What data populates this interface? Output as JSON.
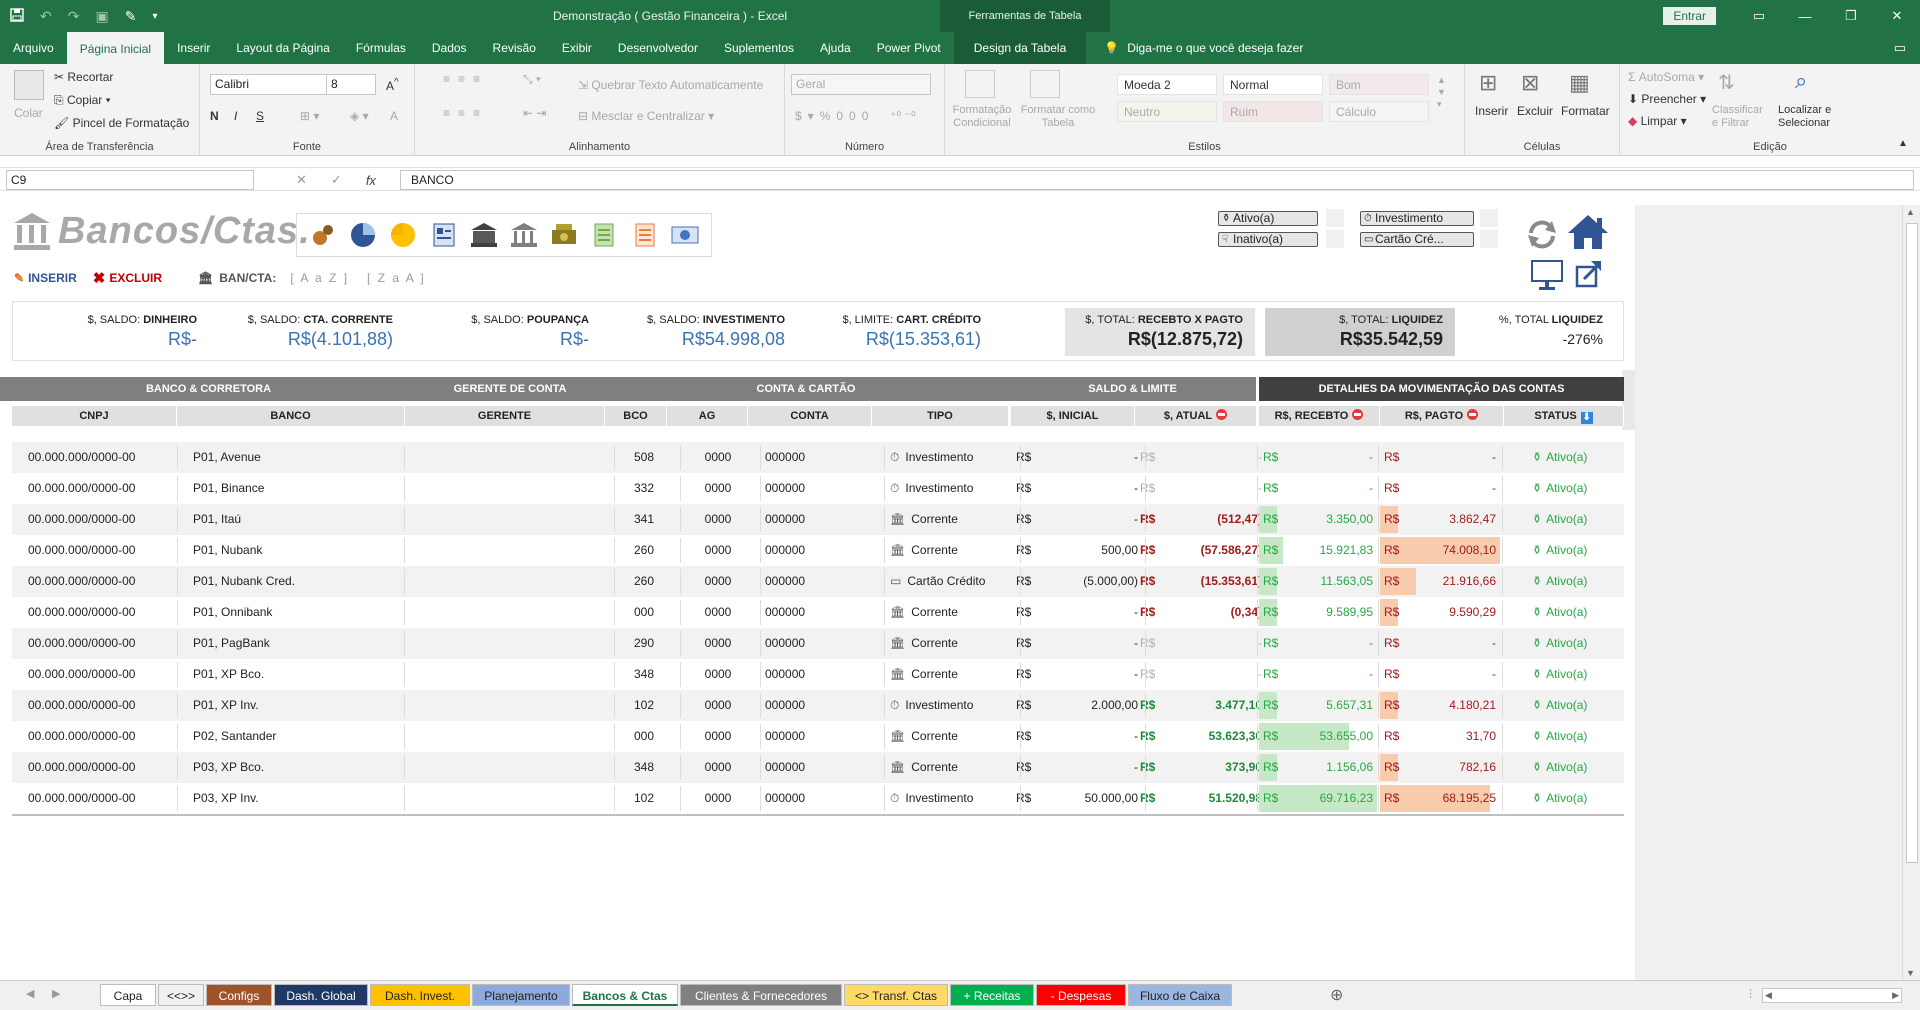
{
  "titlebar": {
    "title": "Demonstração ( Gestão Financeira ) - Excel",
    "tools": "Ferramentas de Tabela",
    "entrar": "Entrar"
  },
  "ribbon_tabs": [
    "Arquivo",
    "Página Inicial",
    "Inserir",
    "Layout da Página",
    "Fórmulas",
    "Dados",
    "Revisão",
    "Exibir",
    "Desenvolvedor",
    "Suplementos",
    "Ajuda",
    "Power Pivot",
    "Design da Tabela"
  ],
  "tell_me": "Diga-me o que você deseja fazer",
  "ribbon": {
    "clipboard": {
      "label": "Área de Transferência",
      "colar": "Colar",
      "recortar": "Recortar",
      "copiar": "Copiar",
      "pincel": "Pincel de Formatação"
    },
    "font": {
      "label": "Fonte",
      "name": "Calibri",
      "size": "8",
      "bold": "N",
      "italic": "I",
      "underline": "S"
    },
    "align": {
      "label": "Alinhamento",
      "wrap": "Quebrar Texto Automaticamente",
      "merge": "Mesclar e Centralizar"
    },
    "number": {
      "label": "Número",
      "format": "Geral"
    },
    "styles": {
      "label": "Estilos",
      "cond": "Formatação Condicional",
      "table": "Formatar como Tabela",
      "cells": [
        "Moeda 2",
        "Normal",
        "Bom",
        "Neutro",
        "Ruim",
        "Cálculo"
      ]
    },
    "cells": {
      "label": "Células",
      "insert": "Inserir",
      "delete": "Excluir",
      "format": "Formatar"
    },
    "editing": {
      "label": "Edição",
      "autosum": "AutoSoma",
      "fill": "Preencher",
      "clear": "Limpar",
      "sort": "Classificar e Filtrar",
      "find": "Localizar e Selecionar"
    }
  },
  "formula_bar": {
    "cell": "C9",
    "value": "BANCO"
  },
  "sheet": {
    "title": "Bancos/Ctas.",
    "legend": {
      "ativo": "Ativo(a)",
      "inativo": "Inativo(a)",
      "investimento": "Investimento",
      "cartao": "Cartão Cré..."
    },
    "actions": {
      "insert": "INSERIR",
      "delete": "EXCLUIR",
      "bancta": "BAN/CTA:",
      "az": "[ A a Z ]",
      "za": "[ Z a A ]"
    },
    "kpis": [
      {
        "prefix": "$, SALDO: ",
        "bold": "DINHEIRO",
        "value": "R$-"
      },
      {
        "prefix": "$, SALDO: ",
        "bold": "CTA. CORRENTE",
        "value": "R$(4.101,88)"
      },
      {
        "prefix": "$, SALDO: ",
        "bold": "POUPANÇA",
        "value": "R$-"
      },
      {
        "prefix": "$, SALDO: ",
        "bold": "INVESTIMENTO",
        "value": "R$54.998,08"
      },
      {
        "prefix": "$, LIMITE: ",
        "bold": "CART. CRÉDITO",
        "value": "R$(15.353,61)"
      },
      {
        "prefix": "$, TOTAL: ",
        "bold": "RECEBTO X PAGTO",
        "value": "R$(12.875,72)"
      },
      {
        "prefix": "$, TOTAL: ",
        "bold": "LIQUIDEZ",
        "value": "R$35.542,59"
      },
      {
        "prefix": "%, TOTAL ",
        "bold": "LIQUIDEZ",
        "value": "-276%"
      }
    ],
    "group_headers": [
      "BANCO & CORRETORA",
      "GERENTE DE CONTA",
      "CONTA & CARTÃO",
      "SALDO  & LIMITE",
      "DETALHES DA MOVIMENTAÇÃO DAS CONTAS"
    ],
    "columns": [
      "CNPJ",
      "BANCO",
      "GERENTE",
      "BCO",
      "AG",
      "CONTA",
      "TIPO",
      "$, INICIAL",
      "$, ATUAL",
      "R$, RECEBTO",
      "R$, PAGTO",
      "STATUS"
    ],
    "rows": [
      {
        "cnpj": "00.000.000/0000-00",
        "banco": "P01, Avenue",
        "bco": "508",
        "ag": "0000",
        "conta": "000000",
        "tipo": "Investimento",
        "inicial": "-",
        "atual": "-",
        "atual_cls": "grayv",
        "rec": "-",
        "rec_bar": 0,
        "pag": "-",
        "pag_bar": 0,
        "status": "Ativo(a)"
      },
      {
        "cnpj": "00.000.000/0000-00",
        "banco": "P01, Binance",
        "bco": "332",
        "ag": "0000",
        "conta": "000000",
        "tipo": "Investimento",
        "inicial": "-",
        "atual": "-",
        "atual_cls": "grayv",
        "rec": "-",
        "rec_bar": 0,
        "pag": "-",
        "pag_bar": 0,
        "status": "Ativo(a)"
      },
      {
        "cnpj": "00.000.000/0000-00",
        "banco": "P01, Itaú",
        "bco": "341",
        "ag": "0000",
        "conta": "000000",
        "tipo": "Corrente",
        "inicial": "-",
        "atual": "(512,47)",
        "atual_cls": "neg",
        "rec": "3.350,00",
        "rec_bar": 0.02,
        "pag": "3.862,47",
        "pag_bar": 0.02,
        "status": "Ativo(a)"
      },
      {
        "cnpj": "00.000.000/0000-00",
        "banco": "P01, Nubank",
        "bco": "260",
        "ag": "0000",
        "conta": "000000",
        "tipo": "Corrente",
        "inicial": "500,00",
        "atual": "(57.586,27)",
        "atual_cls": "neg",
        "rec": "15.921,83",
        "rec_bar": 0.2,
        "pag": "74.008,10",
        "pag_bar": 1,
        "status": "Ativo(a)"
      },
      {
        "cnpj": "00.000.000/0000-00",
        "banco": "P01, Nubank Cred.",
        "bco": "260",
        "ag": "0000",
        "conta": "000000",
        "tipo": "Cartão Crédito",
        "inicial": "(5.000,00)",
        "atual": "(15.353,61)",
        "atual_cls": "neg",
        "rec": "11.563,05",
        "rec_bar": 0.15,
        "pag": "21.916,66",
        "pag_bar": 0.3,
        "status": "Ativo(a)"
      },
      {
        "cnpj": "00.000.000/0000-00",
        "banco": "P01, Onnibank",
        "bco": "000",
        "ag": "0000",
        "conta": "000000",
        "tipo": "Corrente",
        "inicial": "-",
        "atual": "(0,34)",
        "atual_cls": "neg",
        "rec": "9.589,95",
        "rec_bar": 0.12,
        "pag": "9.590,29",
        "pag_bar": 0.13,
        "status": "Ativo(a)"
      },
      {
        "cnpj": "00.000.000/0000-00",
        "banco": "P01, PagBank",
        "bco": "290",
        "ag": "0000",
        "conta": "000000",
        "tipo": "Corrente",
        "inicial": "-",
        "atual": "-",
        "atual_cls": "grayv",
        "rec": "-",
        "rec_bar": 0,
        "pag": "-",
        "pag_bar": 0,
        "status": "Ativo(a)"
      },
      {
        "cnpj": "00.000.000/0000-00",
        "banco": "P01, XP Bco.",
        "bco": "348",
        "ag": "0000",
        "conta": "000000",
        "tipo": "Corrente",
        "inicial": "-",
        "atual": "-",
        "atual_cls": "grayv",
        "rec": "-",
        "rec_bar": 0,
        "pag": "-",
        "pag_bar": 0,
        "status": "Ativo(a)"
      },
      {
        "cnpj": "00.000.000/0000-00",
        "banco": "P01, XP Inv.",
        "bco": "102",
        "ag": "0000",
        "conta": "000000",
        "tipo": "Investimento",
        "inicial": "2.000,00",
        "atual": "3.477,10",
        "atual_cls": "pos",
        "rec": "5.657,31",
        "rec_bar": 0.06,
        "pag": "4.180,21",
        "pag_bar": 0.04,
        "status": "Ativo(a)"
      },
      {
        "cnpj": "00.000.000/0000-00",
        "banco": "P02, Santander",
        "bco": "000",
        "ag": "0000",
        "conta": "000000",
        "tipo": "Corrente",
        "inicial": "-",
        "atual": "53.623,30",
        "atual_cls": "pos",
        "rec": "53.655,00",
        "rec_bar": 0.76,
        "pag": "31,70",
        "pag_bar": 0,
        "status": "Ativo(a)"
      },
      {
        "cnpj": "00.000.000/0000-00",
        "banco": "P03, XP Bco.",
        "bco": "348",
        "ag": "0000",
        "conta": "000000",
        "tipo": "Corrente",
        "inicial": "-",
        "atual": "373,90",
        "atual_cls": "pos",
        "rec": "1.156,06",
        "rec_bar": 0.01,
        "pag": "782,16",
        "pag_bar": 0.01,
        "status": "Ativo(a)"
      },
      {
        "cnpj": "00.000.000/0000-00",
        "banco": "P03, XP Inv.",
        "bco": "102",
        "ag": "0000",
        "conta": "000000",
        "tipo": "Investimento",
        "inicial": "50.000,00",
        "atual": "51.520,98",
        "atual_cls": "pos",
        "rec": "69.716,23",
        "rec_bar": 1,
        "pag": "68.195,25",
        "pag_bar": 0.92,
        "status": "Ativo(a)"
      }
    ]
  },
  "sheet_tabs": [
    {
      "name": "Capa",
      "bg": "#ffffff",
      "fg": "#222222"
    },
    {
      "name": "<<>>",
      "bg": "#f0f0f0",
      "fg": "#222222"
    },
    {
      "name": "Configs",
      "bg": "#a0522d",
      "fg": "#ffffff"
    },
    {
      "name": "Dash. Global",
      "bg": "#1f3864",
      "fg": "#ffffff"
    },
    {
      "name": "Dash. Invest.",
      "bg": "#ffc000",
      "fg": "#222222"
    },
    {
      "name": "Planejamento",
      "bg": "#8ea9db",
      "fg": "#222222"
    },
    {
      "name": "Bancos & Ctas",
      "bg": "#ffffff",
      "fg": "#217346"
    },
    {
      "name": "Clientes & Fornecedores",
      "bg": "#808080",
      "fg": "#ffffff"
    },
    {
      "name": "<> Transf. Ctas",
      "bg": "#ffd966",
      "fg": "#222222"
    },
    {
      "name": "+ Receitas",
      "bg": "#00b050",
      "fg": "#ffffff"
    },
    {
      "name": "- Despesas",
      "bg": "#ff0000",
      "fg": "#ffffff"
    },
    {
      "name": "Fluxo de Caixa",
      "bg": "#9bb7e0",
      "fg": "#222222"
    }
  ]
}
